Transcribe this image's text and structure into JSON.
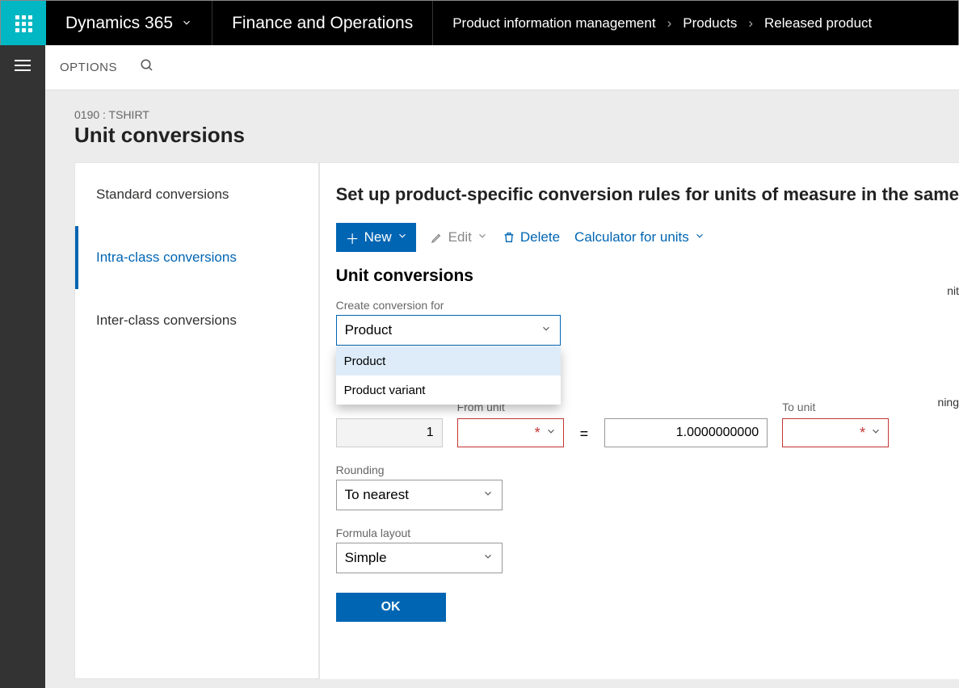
{
  "topbar": {
    "brand": "Dynamics 365",
    "module": "Finance and Operations",
    "crumbs": [
      "Product information management",
      "Products",
      "Released product"
    ]
  },
  "actionstrip": {
    "options": "OPTIONS"
  },
  "page": {
    "id_line": "0190 : TSHIRT",
    "title": "Unit conversions"
  },
  "tabs": {
    "items": [
      {
        "label": "Standard conversions",
        "active": false
      },
      {
        "label": "Intra-class conversions",
        "active": true
      },
      {
        "label": "Inter-class conversions",
        "active": false
      }
    ]
  },
  "pane": {
    "header": "Set up product-specific conversion rules for units of measure in the same",
    "new_label": "New",
    "edit_label": "Edit",
    "delete_label": "Delete",
    "calc_label": "Calculator for units"
  },
  "flyout": {
    "title": "Unit conversions",
    "create_for_label": "Create conversion for",
    "create_for_value": "Product",
    "create_for_options": [
      "Product",
      "Product variant"
    ],
    "left_value": "1",
    "from_unit_label": "From unit",
    "equals": "=",
    "right_value": "1.0000000000",
    "to_unit_label": "To unit",
    "rounding_label": "Rounding",
    "rounding_value": "To nearest",
    "formula_label": "Formula layout",
    "formula_value": "Simple",
    "ok": "OK"
  },
  "cropped": {
    "nit": "nit",
    "ning": "ning"
  }
}
